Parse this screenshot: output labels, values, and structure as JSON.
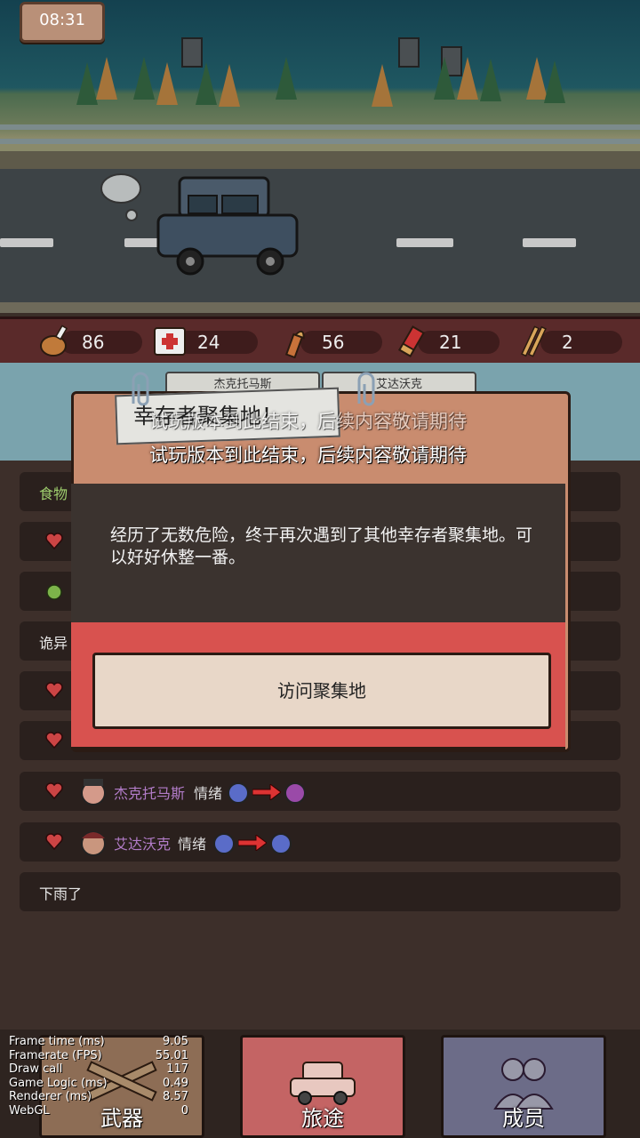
{
  "clock": "08:31",
  "resources": [
    {
      "icon": "meat-icon",
      "value": "86"
    },
    {
      "icon": "medkit-icon",
      "value": "24"
    },
    {
      "icon": "bullet-icon",
      "value": "56"
    },
    {
      "icon": "shotgun-shell-icon",
      "value": "21"
    },
    {
      "icon": "rifle-ammo-icon",
      "value": "2"
    }
  ],
  "party_tabs": [
    "杰克托马斯",
    "艾达沃克"
  ],
  "overlay_notice": "试玩版本到此结束，后续内容敬请期待",
  "dialog": {
    "title": "幸存者聚集地！",
    "body": "经历了无数危险，终于再次遇到了其他幸存者聚集地。可以好好休整一番。",
    "button": "访问聚集地"
  },
  "log": {
    "food_label": "食物",
    "weird_label": "诡异",
    "row_jack": {
      "name": "杰克托马斯",
      "text": "情绪"
    },
    "row_ada": {
      "name": "艾达沃克",
      "text": "情绪"
    },
    "rain": "下雨了"
  },
  "nav": {
    "weapons": "武器",
    "journey": "旅途",
    "members": "成员"
  },
  "debug": [
    {
      "k": "Frame time (ms)",
      "v": "9.05"
    },
    {
      "k": "Framerate (FPS)",
      "v": "55.01"
    },
    {
      "k": "Draw call",
      "v": "117"
    },
    {
      "k": "Game Logic (ms)",
      "v": "0.49"
    },
    {
      "k": "Renderer (ms)",
      "v": "8.57"
    },
    {
      "k": "WebGL",
      "v": "0"
    }
  ],
  "colors": {
    "accent_red": "#d8524f",
    "party_bg": "#7aa3ad",
    "name_purple": "#b27cc8",
    "food_green": "#9fcf6e"
  }
}
